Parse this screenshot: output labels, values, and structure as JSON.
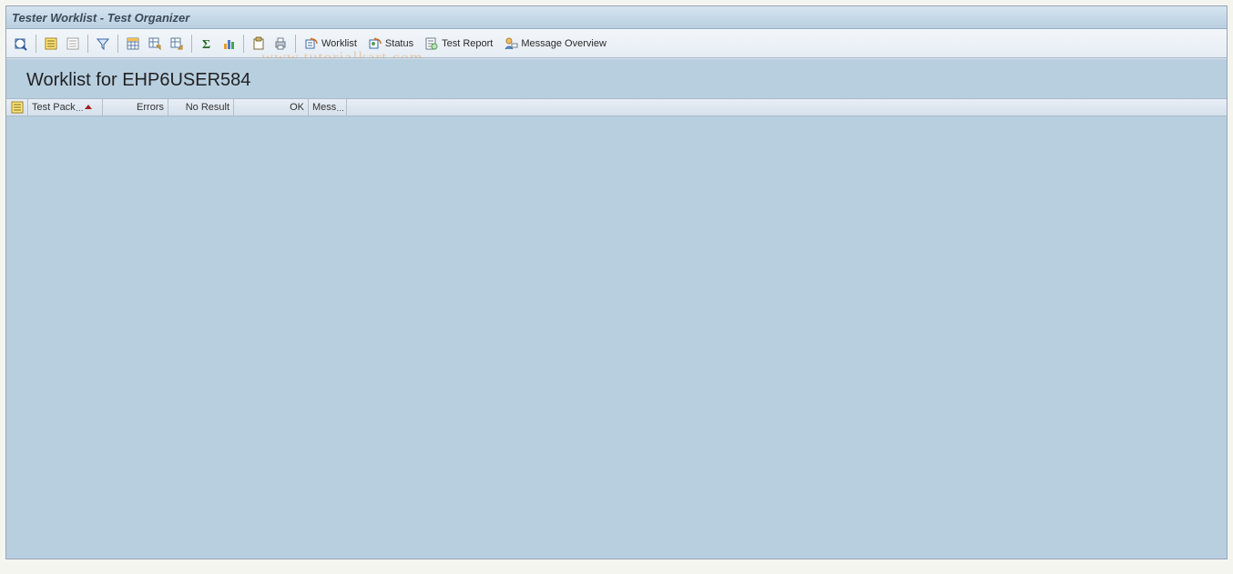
{
  "window": {
    "title": "Tester Worklist - Test Organizer"
  },
  "toolbar": {
    "worklist_label": "Worklist",
    "status_label": "Status",
    "testreport_label": "Test Report",
    "msgoverview_label": "Message Overview"
  },
  "content": {
    "heading": "Worklist for EHP6USER584"
  },
  "grid": {
    "columns": {
      "test_pack": "Test Pack",
      "errors": "Errors",
      "no_result": "No Result",
      "ok": "OK",
      "mess": "Mess"
    }
  },
  "watermark": "www.tutorialkart.com"
}
